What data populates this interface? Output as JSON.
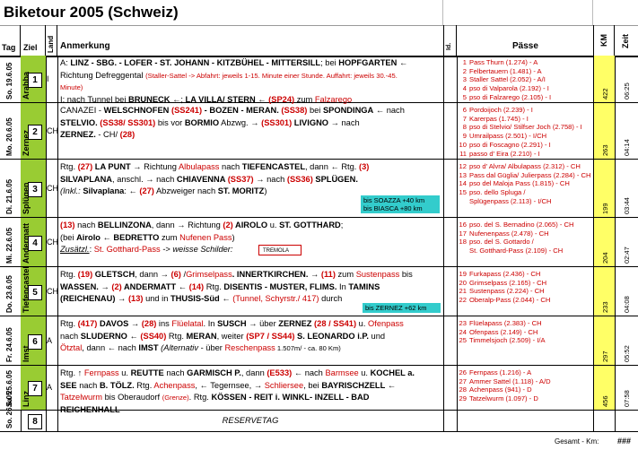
{
  "title": "Biketour 2005 (Schweiz)",
  "headers": {
    "tag": "Tag",
    "ziel": "Ziel",
    "land": "Land",
    "anmerkung": "Anmerkung",
    "id": "Id.",
    "paesse": "Pässe",
    "km": "KM",
    "zeit": "Zeit"
  },
  "rows": [
    {
      "day": "So. 19.6.05",
      "ziel": "Arabba",
      "num": "1",
      "land": "I",
      "km": "422",
      "zeit": "06:25",
      "lines": [
        [
          {
            "t": "A: ",
            "c": ""
          },
          {
            "t": "LINZ - SBG. - LOFER - ST. JOHANN - KITZBÜHEL - MITTERSILL",
            "c": "b"
          },
          {
            "t": "; bei ",
            "c": ""
          },
          {
            "t": "HOPFGARTEN",
            "c": "b"
          },
          {
            "t": " ←",
            "c": "b"
          }
        ],
        [
          {
            "t": "Richtung Defreggental ",
            "c": ""
          },
          {
            "t": "(Staller-Sattel -> Abfahrt: jeweils 1-15. Minute einer Stunde. Auffahrt: jeweils 30.-45.",
            "c": "red small"
          }
        ],
        [
          {
            "t": "Minute)",
            "c": "red small"
          }
        ],
        [
          {
            "t": "I: nach Tunnel bei ",
            "c": ""
          },
          {
            "t": "BRUNECK",
            "c": "b"
          },
          {
            "t": " ←;  ",
            "c": ""
          },
          {
            "t": "LA VILLA/ STERN",
            "c": "b"
          },
          {
            "t": " ← ",
            "c": ""
          },
          {
            "t": "(SP24)",
            "c": "red b"
          },
          {
            "t": " zum ",
            "c": ""
          },
          {
            "t": "Falzarego",
            "c": "red"
          }
        ]
      ],
      "passes": [
        [
          "1",
          "Pass Thurn (1.274) - A"
        ],
        [
          "2",
          "Felbertauern (1.481) - A"
        ],
        [
          "3",
          "Staller Sattel (2.052) - A/I"
        ],
        [
          "4",
          "pso di Valparola (2.192) - I"
        ],
        [
          "5",
          "pso di Falzarego (2.105) - I"
        ]
      ]
    },
    {
      "day": "Mo. 20.6.05",
      "ziel": "Zernez",
      "num": "2",
      "land": "CH",
      "km": "263",
      "zeit": "04:14",
      "lines": [
        [
          {
            "t": "CANAZEI - ",
            "c": ""
          },
          {
            "t": "WELSCHNOFEN",
            "c": "b"
          },
          {
            "t": " (SS241)",
            "c": "red b"
          },
          {
            "t": " - BOZEN - MERAN.",
            "c": "b"
          },
          {
            "t": " (SS38)",
            "c": "red b"
          },
          {
            "t": " bei ",
            "c": ""
          },
          {
            "t": "SPONDINGA",
            "c": "b"
          },
          {
            "t": " ← nach",
            "c": ""
          }
        ],
        [
          {
            "t": "STELVIO. ",
            "c": "b"
          },
          {
            "t": "(SS38/ SS301)",
            "c": "red b"
          },
          {
            "t": " bis vor ",
            "c": ""
          },
          {
            "t": "BORMIO",
            "c": "b"
          },
          {
            "t": " Abzwg. → ",
            "c": ""
          },
          {
            "t": "(SS301)",
            "c": "red b"
          },
          {
            "t": " LIVIGNO",
            "c": "b"
          },
          {
            "t": " → nach",
            "c": ""
          }
        ],
        [
          {
            "t": "ZERNEZ.",
            "c": "b"
          },
          {
            "t": " - CH/ ",
            "c": ""
          },
          {
            "t": "(28)",
            "c": "red b"
          }
        ]
      ],
      "passes": [
        [
          "6",
          "Pordoijoch (2.239) - I"
        ],
        [
          "7",
          "Karerpas (1.745) - I"
        ],
        [
          "8",
          "pso di Stelvio/ Stilfser Joch (2.758) - I"
        ],
        [
          "9",
          "Umrailpass (2.501) - I/CH"
        ],
        [
          "10",
          "pso di Foscagno (2.291) - I"
        ],
        [
          "11",
          "passo d' Eira (2.210) - I"
        ]
      ]
    },
    {
      "day": "Di. 21.6.05",
      "ziel": "Splügen",
      "num": "3",
      "land": "CH",
      "km": "199",
      "zeit": "03:44",
      "lines": [
        [
          {
            "t": "Rtg. ",
            "c": ""
          },
          {
            "t": "(27)",
            "c": "red b"
          },
          {
            "t": " LA PUNT",
            "c": "b"
          },
          {
            "t": " → Richtung ",
            "c": ""
          },
          {
            "t": "Albulapass",
            "c": "red"
          },
          {
            "t": " nach ",
            "c": ""
          },
          {
            "t": "TIEFENCASTEL",
            "c": "b"
          },
          {
            "t": ", dann ← Rtg. ",
            "c": ""
          },
          {
            "t": "(3)",
            "c": "red b"
          }
        ],
        [
          {
            "t": "SILVAPLANA",
            "c": "b"
          },
          {
            "t": ", anschl. →     nach ",
            "c": ""
          },
          {
            "t": "CHIAVENNA",
            "c": "b"
          },
          {
            "t": " (SS37)",
            "c": "red b"
          },
          {
            "t": " → nach ",
            "c": ""
          },
          {
            "t": "(SS36)",
            "c": "red b"
          },
          {
            "t": " SPLÜGEN.",
            "c": "b"
          }
        ],
        [
          {
            "t": "(Inkl.: ",
            "c": "i"
          },
          {
            "t": "Silvaplana",
            "c": "b"
          },
          {
            "t": ": ← ",
            "c": ""
          },
          {
            "t": "(27)",
            "c": "red b"
          },
          {
            "t": " Abzweiger nach ",
            "c": ""
          },
          {
            "t": "ST. MORITZ",
            "c": "b"
          },
          {
            "t": ")",
            "c": ""
          }
        ]
      ],
      "cyan": [
        "bis SOAZZA  +40 km",
        "bis BIASCA  +80 km"
      ],
      "passes": [
        [
          "12",
          "pso d' Alvra/ Albulapass (2.312) - CH"
        ],
        [
          "13",
          "Pass dal Güglia/ Julierpass (2.284) - CH"
        ],
        [
          "14",
          "pso del Maloja Pass (1.815) - CH"
        ],
        [
          "15",
          "pso. dello Spluga /"
        ],
        [
          "",
          "Splügenpass (2.113) - I/CH"
        ]
      ]
    },
    {
      "day": "Mi. 22.6.05",
      "ziel": "Andermatt",
      "num": "4",
      "land": "CH",
      "km": "204",
      "zeit": "02:47",
      "lines": [
        [
          {
            "t": "(13)",
            "c": "red b"
          },
          {
            "t": " nach ",
            "c": ""
          },
          {
            "t": "BELLINZONA",
            "c": "b"
          },
          {
            "t": ", dann → Richtung ",
            "c": ""
          },
          {
            "t": "(2)",
            "c": "red b"
          },
          {
            "t": " AIROLO",
            "c": "b"
          },
          {
            "t": " u. ",
            "c": ""
          },
          {
            "t": "ST. GOTTHARD",
            "c": "b"
          },
          {
            "t": ";",
            "c": ""
          }
        ],
        [
          {
            "t": "(bei ",
            "c": ""
          },
          {
            "t": "Airolo",
            "c": "b"
          },
          {
            "t": " ← ",
            "c": ""
          },
          {
            "t": "BEDRETTO",
            "c": "b"
          },
          {
            "t": " zum ",
            "c": ""
          },
          {
            "t": "Nufenen Pass",
            "c": "red"
          },
          {
            "t": ")",
            "c": ""
          }
        ],
        [
          {
            "t": "Zusätzl.",
            "c": "u i"
          },
          {
            "t": ":  ",
            "c": ""
          },
          {
            "t": "St. Gotthard-Pass",
            "c": "red"
          },
          {
            "t": " -> weisse Schilder:",
            "c": "i"
          }
        ]
      ],
      "sign": "TREMOLA",
      "passes": [
        [
          "16",
          "pso. del S. Bernadino (2.065) - CH"
        ],
        [
          "17",
          "Nufenenpass (2.478) - CH"
        ],
        [
          "18",
          "pso. del S. Gottardo /"
        ],
        [
          "",
          "St. Gotthard-Pass (2.109) - CH"
        ]
      ]
    },
    {
      "day": "Do. 23.6.05",
      "ziel": "Tiefencastel",
      "num": "5",
      "land": "CH",
      "km": "233",
      "zeit": "04:08",
      "lines": [
        [
          {
            "t": "Rtg. ",
            "c": ""
          },
          {
            "t": "(19)",
            "c": "red b"
          },
          {
            "t": " GLETSCH",
            "c": "b"
          },
          {
            "t": ", dann → ",
            "c": ""
          },
          {
            "t": "(6)",
            "c": "red b"
          },
          {
            "t": " /",
            "c": ""
          },
          {
            "t": "Grimselpass",
            "c": "red"
          },
          {
            "t": ". INNERTKIRCHEN.",
            "c": "b"
          },
          {
            "t": " → ",
            "c": ""
          },
          {
            "t": "(11)",
            "c": "red b"
          },
          {
            "t": " zum ",
            "c": ""
          },
          {
            "t": "Sustenpass",
            "c": "red"
          },
          {
            "t": " bis",
            "c": ""
          }
        ],
        [
          {
            "t": "WASSEN.",
            "c": "b"
          },
          {
            "t": " → ",
            "c": ""
          },
          {
            "t": "(2)",
            "c": "red b"
          },
          {
            "t": " ANDERMATT",
            "c": "b"
          },
          {
            "t": " ← ",
            "c": ""
          },
          {
            "t": "(14)",
            "c": "red b"
          },
          {
            "t": " Rtg. ",
            "c": ""
          },
          {
            "t": "DISENTIS - MUSTER, FLIMS.",
            "c": "b"
          },
          {
            "t": " In ",
            "c": ""
          },
          {
            "t": "TAMINS",
            "c": "b"
          }
        ],
        [
          {
            "t": "(REICHENAU)",
            "c": "b"
          },
          {
            "t": " → ",
            "c": ""
          },
          {
            "t": "(13)",
            "c": "red b"
          },
          {
            "t": " und in ",
            "c": ""
          },
          {
            "t": "THUSIS-Süd",
            "c": "b"
          },
          {
            "t": " ← ",
            "c": ""
          },
          {
            "t": "(Tunnel, Schyrstr./ 417)",
            "c": "red"
          },
          {
            "t": " durch",
            "c": ""
          }
        ]
      ],
      "cyan": [
        "bis ZERNEZ +62 km"
      ],
      "passes": [
        [
          "19",
          "Furkapass (2.436) - CH"
        ],
        [
          "20",
          "Grimselpass (2.165) - CH"
        ],
        [
          "21",
          "Sustenpass (2.224) - CH"
        ],
        [
          "22",
          "Oberalp-Pass (2.044) - CH"
        ]
      ]
    },
    {
      "day": "Fr. 24.6.05",
      "ziel": "Imst",
      "num": "6",
      "land": "A",
      "km": "297",
      "zeit": "05:52",
      "lines": [
        [
          {
            "t": "Rtg. ",
            "c": ""
          },
          {
            "t": "(417)",
            "c": "red b"
          },
          {
            "t": " DAVOS",
            "c": "b"
          },
          {
            "t": " → ",
            "c": ""
          },
          {
            "t": "(28)",
            "c": "red b"
          },
          {
            "t": " ins ",
            "c": ""
          },
          {
            "t": "Flüelatal",
            "c": "red"
          },
          {
            "t": ". In ",
            "c": ""
          },
          {
            "t": "SUSCH",
            "c": "b"
          },
          {
            "t": " →    über ",
            "c": ""
          },
          {
            "t": "ZERNEZ",
            "c": "b"
          },
          {
            "t": " (28 / SS41)",
            "c": "red b"
          },
          {
            "t": " u. ",
            "c": ""
          },
          {
            "t": "Ofenpass",
            "c": "red"
          }
        ],
        [
          {
            "t": "nach ",
            "c": ""
          },
          {
            "t": "SLUDERNO",
            "c": "b"
          },
          {
            "t": " ← ",
            "c": ""
          },
          {
            "t": "(SS40)",
            "c": "red b"
          },
          {
            "t": " Rtg. ",
            "c": ""
          },
          {
            "t": "MERAN",
            "c": "b"
          },
          {
            "t": ", weiter ",
            "c": ""
          },
          {
            "t": "(SP7 / SS44)",
            "c": "red b"
          },
          {
            "t": " S. LEONARDO i.P.",
            "c": "b"
          },
          {
            "t": " und",
            "c": ""
          }
        ],
        [
          {
            "t": "Ötztal",
            "c": "red"
          },
          {
            "t": ", dann ← nach ",
            "c": ""
          },
          {
            "t": "IMST",
            "c": "b"
          },
          {
            "t": "     (Alternativ",
            "c": "i"
          },
          {
            "t": " - über ",
            "c": ""
          },
          {
            "t": "Reschenpass",
            "c": "red"
          },
          {
            "t": " 1.507m/ - ca. 80 Km)",
            "c": "small"
          }
        ]
      ],
      "passes": [
        [
          "23",
          "Flüelapass (2.383) - CH"
        ],
        [
          "24",
          "Ofenpass (2.149) - CH"
        ],
        [
          "25",
          "Timmelsjoch (2.509) - I/A"
        ]
      ]
    },
    {
      "day": "Sa. 25.6.05",
      "ziel": "Linz",
      "num": "7",
      "land": "A",
      "km": "456",
      "zeit": "07:58",
      "lines": [
        [
          {
            "t": "Rtg. ↑ ",
            "c": ""
          },
          {
            "t": "Fernpass",
            "c": "red"
          },
          {
            "t": " u. ",
            "c": ""
          },
          {
            "t": "REUTTE",
            "c": "b"
          },
          {
            "t": " nach ",
            "c": ""
          },
          {
            "t": "GARMISCH P.",
            "c": "b"
          },
          {
            "t": ", dann ",
            "c": ""
          },
          {
            "t": "(E533)",
            "c": "red b"
          },
          {
            "t": " ← nach ",
            "c": ""
          },
          {
            "t": "Barmsee",
            "c": "red"
          },
          {
            "t": " u. ",
            "c": ""
          },
          {
            "t": "KOCHEL a.",
            "c": "b"
          }
        ],
        [
          {
            "t": "SEE",
            "c": "b"
          },
          {
            "t": " nach ",
            "c": ""
          },
          {
            "t": "B. TÖLZ.",
            "c": "b"
          },
          {
            "t": " Rtg. ",
            "c": ""
          },
          {
            "t": "Achenpass",
            "c": "red"
          },
          {
            "t": ", ← Tegernsee, → ",
            "c": ""
          },
          {
            "t": "Schliersee",
            "c": "red"
          },
          {
            "t": ", bei ",
            "c": ""
          },
          {
            "t": "BAYRISCHZELL",
            "c": "b"
          },
          {
            "t": " ←",
            "c": ""
          }
        ],
        [
          {
            "t": "Tatzelwurm",
            "c": "red"
          },
          {
            "t": " bis Oberaudorf ",
            "c": ""
          },
          {
            "t": "(Grenze)",
            "c": "red small"
          },
          {
            "t": ". Rtg. ",
            "c": ""
          },
          {
            "t": "KÖSSEN - REIT i. WINKL- INZELL - BAD",
            "c": "b"
          }
        ],
        [
          {
            "t": "REICHENHALL",
            "c": "b"
          }
        ]
      ],
      "passes": [
        [
          "26",
          "Fernpass (1.216) - A"
        ],
        [
          "27",
          "Ammer Sattel (1.118) - A/D"
        ],
        [
          "28",
          "Achenpass (941) - D"
        ],
        [
          "29",
          "Tatzelwurm (1.097) - D"
        ]
      ]
    },
    {
      "day": "So. 26.6.05",
      "ziel": "",
      "num": "8",
      "land": "",
      "km": "",
      "zeit": "",
      "lines": [
        [
          {
            "t": "RESERVETAG",
            "c": "i"
          }
        ]
      ],
      "passes": []
    }
  ],
  "footer": {
    "gesamt": "Gesamt - Km:",
    "total": "###"
  }
}
